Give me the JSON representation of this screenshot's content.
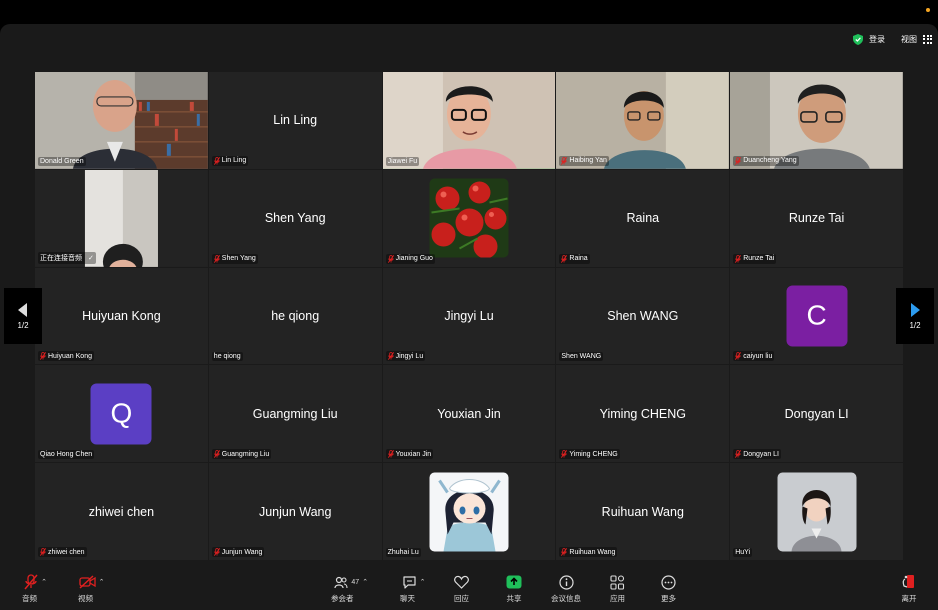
{
  "topbar": {
    "signin": "登录",
    "view": "视图"
  },
  "pagination": {
    "prev": "1/2",
    "next": "1/2"
  },
  "tiles": [
    {
      "center": "",
      "label": "Donald Green",
      "muted": false,
      "kind": "video1"
    },
    {
      "center": "Lin Ling",
      "label": "Lin Ling",
      "muted": true
    },
    {
      "center": "",
      "label": "Jiawei Fu",
      "muted": false,
      "kind": "video2",
      "active": true
    },
    {
      "center": "",
      "label": "Haibing Yan",
      "muted": true,
      "kind": "video3"
    },
    {
      "center": "",
      "label": "Duancheng Yang",
      "muted": true,
      "kind": "video4"
    },
    {
      "center": "",
      "label": "正在连接音频",
      "muted": false,
      "kind": "video5",
      "connecting": true
    },
    {
      "center": "Shen Yang",
      "label": "Shen Yang",
      "muted": true
    },
    {
      "center": "",
      "label": "Jianing Guo",
      "muted": true,
      "kind": "tomato"
    },
    {
      "center": "Raina",
      "label": "Raina",
      "muted": true
    },
    {
      "center": "Runze Tai",
      "label": "Runze Tai",
      "muted": true
    },
    {
      "center": "Huiyuan Kong",
      "label": "Huiyuan Kong",
      "muted": true
    },
    {
      "center": "he qiong",
      "label": "he qiong",
      "muted": false
    },
    {
      "center": "Jingyi Lu",
      "label": "Jingyi Lu",
      "muted": true
    },
    {
      "center": "Shen WANG",
      "label": "Shen WANG",
      "muted": false
    },
    {
      "center": "",
      "label": "caiyun liu",
      "muted": true,
      "kind": "letter",
      "letter": "C",
      "color": "#7b1fa2"
    },
    {
      "center": "",
      "label": "Qiao Hong Chen",
      "muted": false,
      "kind": "letter",
      "letter": "Q",
      "color": "#5b3fc4"
    },
    {
      "center": "Guangming Liu",
      "label": "Guangming Liu",
      "muted": true
    },
    {
      "center": "Youxian Jin",
      "label": "Youxian Jin",
      "muted": true
    },
    {
      "center": "Yiming CHENG",
      "label": "Yiming CHENG",
      "muted": true
    },
    {
      "center": "Dongyan LI",
      "label": "Dongyan LI",
      "muted": true
    },
    {
      "center": "zhiwei chen",
      "label": "zhiwei chen",
      "muted": true
    },
    {
      "center": "Junjun Wang",
      "label": "Junjun Wang",
      "muted": true
    },
    {
      "center": "",
      "label": "Zhuhai Lu",
      "muted": false,
      "kind": "anime"
    },
    {
      "center": "Ruihuan Wang",
      "label": "Ruihuan Wang",
      "muted": true
    },
    {
      "center": "",
      "label": "HuYi",
      "muted": false,
      "kind": "photo"
    }
  ],
  "toolbar": {
    "audio": "音频",
    "video": "视频",
    "participants": "参会者",
    "participants_count": "47",
    "chat": "聊天",
    "reactions": "回应",
    "share": "共享",
    "meeting_info": "会议信息",
    "apps": "应用",
    "more": "更多",
    "leave": "离开"
  },
  "colors": {
    "active_border": "#3fbf5b",
    "muted_mic": "#e02020",
    "share_green": "#1fbf5a",
    "leave_red": "#e02020"
  }
}
